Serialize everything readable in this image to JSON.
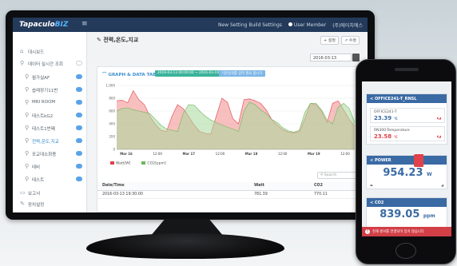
{
  "app": {
    "logo_main": "Tapaculo",
    "logo_sub": "BIZ"
  },
  "topbar": {
    "settings_label": "New Setting Build Settings",
    "user_label": "User Member",
    "account_label": "(주)에이치에스"
  },
  "sidebar": {
    "items": [
      {
        "label": "대시보드",
        "icon": "home-icon"
      },
      {
        "label": "데이터 실시간 조회",
        "icon": "search-icon"
      },
      {
        "label": "월가실AF",
        "icon": "search-icon"
      },
      {
        "label": "숍례장기11번",
        "icon": "search-icon"
      },
      {
        "label": "MRI ROOM",
        "icon": "search-icon"
      },
      {
        "label": "테스트kG2",
        "icon": "search-icon"
      },
      {
        "label": "테스트1번째",
        "icon": "search-icon"
      },
      {
        "label": "전력,온도,지교",
        "icon": "search-icon"
      },
      {
        "label": "포교대소화용",
        "icon": "search-icon"
      },
      {
        "label": "테비",
        "icon": "search-icon"
      },
      {
        "label": "테스트",
        "icon": "search-icon"
      },
      {
        "label": "보고서",
        "icon": "document-icon"
      },
      {
        "label": "장치설정",
        "icon": "wrench-icon"
      },
      {
        "label": "알람설정",
        "icon": "bell-icon"
      }
    ]
  },
  "page": {
    "title": "전력,온도,지교",
    "buttons": [
      "+ 설정",
      "↗ 수정"
    ],
    "date_value": "2016-03-13"
  },
  "panel": {
    "title": "GRAPH & DATA TABLE",
    "chip_range": "2016-03-13 00:00:00 ~ 2016-03-19 23:59:59",
    "chip_note": "기준일자를 입력 필요 합니다"
  },
  "chart_data": {
    "type": "area",
    "x_ticks": [
      "Mar 16",
      "12:00",
      "Mar 17",
      "12:00",
      "Mar 18",
      "12:00",
      "Mar 19",
      "12:00"
    ],
    "y_ticks": [
      0,
      200,
      400,
      600,
      800,
      1000
    ],
    "ylim": [
      0,
      1000
    ],
    "legend": "bottom",
    "series": [
      {
        "name": "Watt[W]",
        "color": "#f28b8b",
        "values": [
          760,
          770,
          730,
          920,
          780,
          700,
          520,
          390,
          300,
          280,
          520,
          700,
          640,
          520,
          380,
          280,
          250,
          240,
          520,
          800,
          740,
          480,
          400,
          780,
          790,
          760,
          720,
          620,
          470,
          380,
          310,
          270,
          260,
          280,
          480,
          720,
          700,
          600,
          420,
          720,
          760,
          620,
          470,
          360
        ]
      },
      {
        "name": "CO2[ppm]",
        "color": "#a8d99a",
        "values": [
          600,
          640,
          650,
          620,
          600,
          580,
          560,
          470,
          380,
          320,
          300,
          280,
          560,
          700,
          690,
          600,
          520,
          460,
          420,
          380,
          350,
          320,
          280,
          600,
          740,
          700,
          620,
          560,
          470,
          420,
          340,
          290,
          270,
          300,
          580,
          720,
          720,
          620,
          460,
          400,
          660,
          720,
          640,
          420
        ]
      }
    ]
  },
  "table": {
    "search_placeholder": "Search",
    "headers": [
      "Date/Time",
      "Watt",
      "CO2"
    ],
    "rows": [
      [
        "2016-03-13 19:30:00",
        "781.39",
        "770.11"
      ]
    ]
  },
  "phone": {
    "card1_title": "OFFICE241-T_RNSL",
    "sensors": [
      {
        "name": "OFFICE241-T",
        "value": "23.39",
        "unit": "°C"
      },
      {
        "name": "RN300-Temperature",
        "value": "23.58",
        "unit": "°C"
      }
    ],
    "power_title": "POWER",
    "power_value": "954.23",
    "power_unit": "W",
    "co2_title": "CO2",
    "co2_value": "839.05",
    "co2_unit": "ppm",
    "alert_text": "현재 센서를 연결되어 있지 않습니다"
  },
  "colors": {
    "nav": "#233a5a",
    "accent": "#3a8fd1",
    "alert": "#d23f47"
  }
}
